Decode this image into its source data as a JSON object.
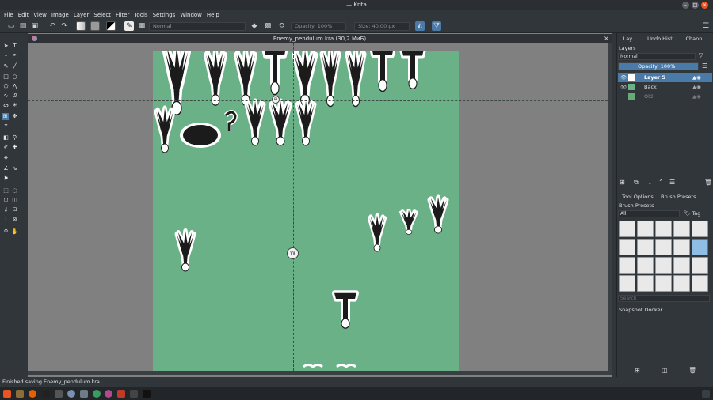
{
  "window": {
    "title": "— Krita"
  },
  "menu": [
    "File",
    "Edit",
    "View",
    "Image",
    "Layer",
    "Select",
    "Filter",
    "Tools",
    "Settings",
    "Window",
    "Help"
  ],
  "toolbar": {
    "blend_mode": "Normal",
    "opacity": "Opacity: 100%",
    "size": "Size: 40,00 px"
  },
  "document": {
    "tab_title": "Enemy_pendulum.kra (30,2 МиБ)"
  },
  "docker_tabs": [
    "Lay...",
    "Undo Hist...",
    "Chann..."
  ],
  "layers_panel": {
    "title": "Layers",
    "blend_mode": "Normal",
    "opacity": "Opacity:  100%",
    "items": [
      {
        "name": "Layer 5",
        "selected": true,
        "visible": true
      },
      {
        "name": "Back",
        "selected": false,
        "visible": true
      },
      {
        "name": "Old",
        "selected": false,
        "visible": false
      }
    ]
  },
  "lower_tabs": [
    "Tool Options",
    "Brush Presets"
  ],
  "brush_presets": {
    "title": "Brush Presets",
    "filter": "All",
    "tag_label": "Tag",
    "search_placeholder": "Search"
  },
  "snapshot": {
    "title": "Snapshot Docker"
  },
  "status": {
    "message": "Finished saving Enemy_pendulum.kra"
  },
  "colors": {
    "canvas_bg": "#6ab187",
    "selection": "#4a7ba8",
    "window_bg": "#31363b"
  }
}
